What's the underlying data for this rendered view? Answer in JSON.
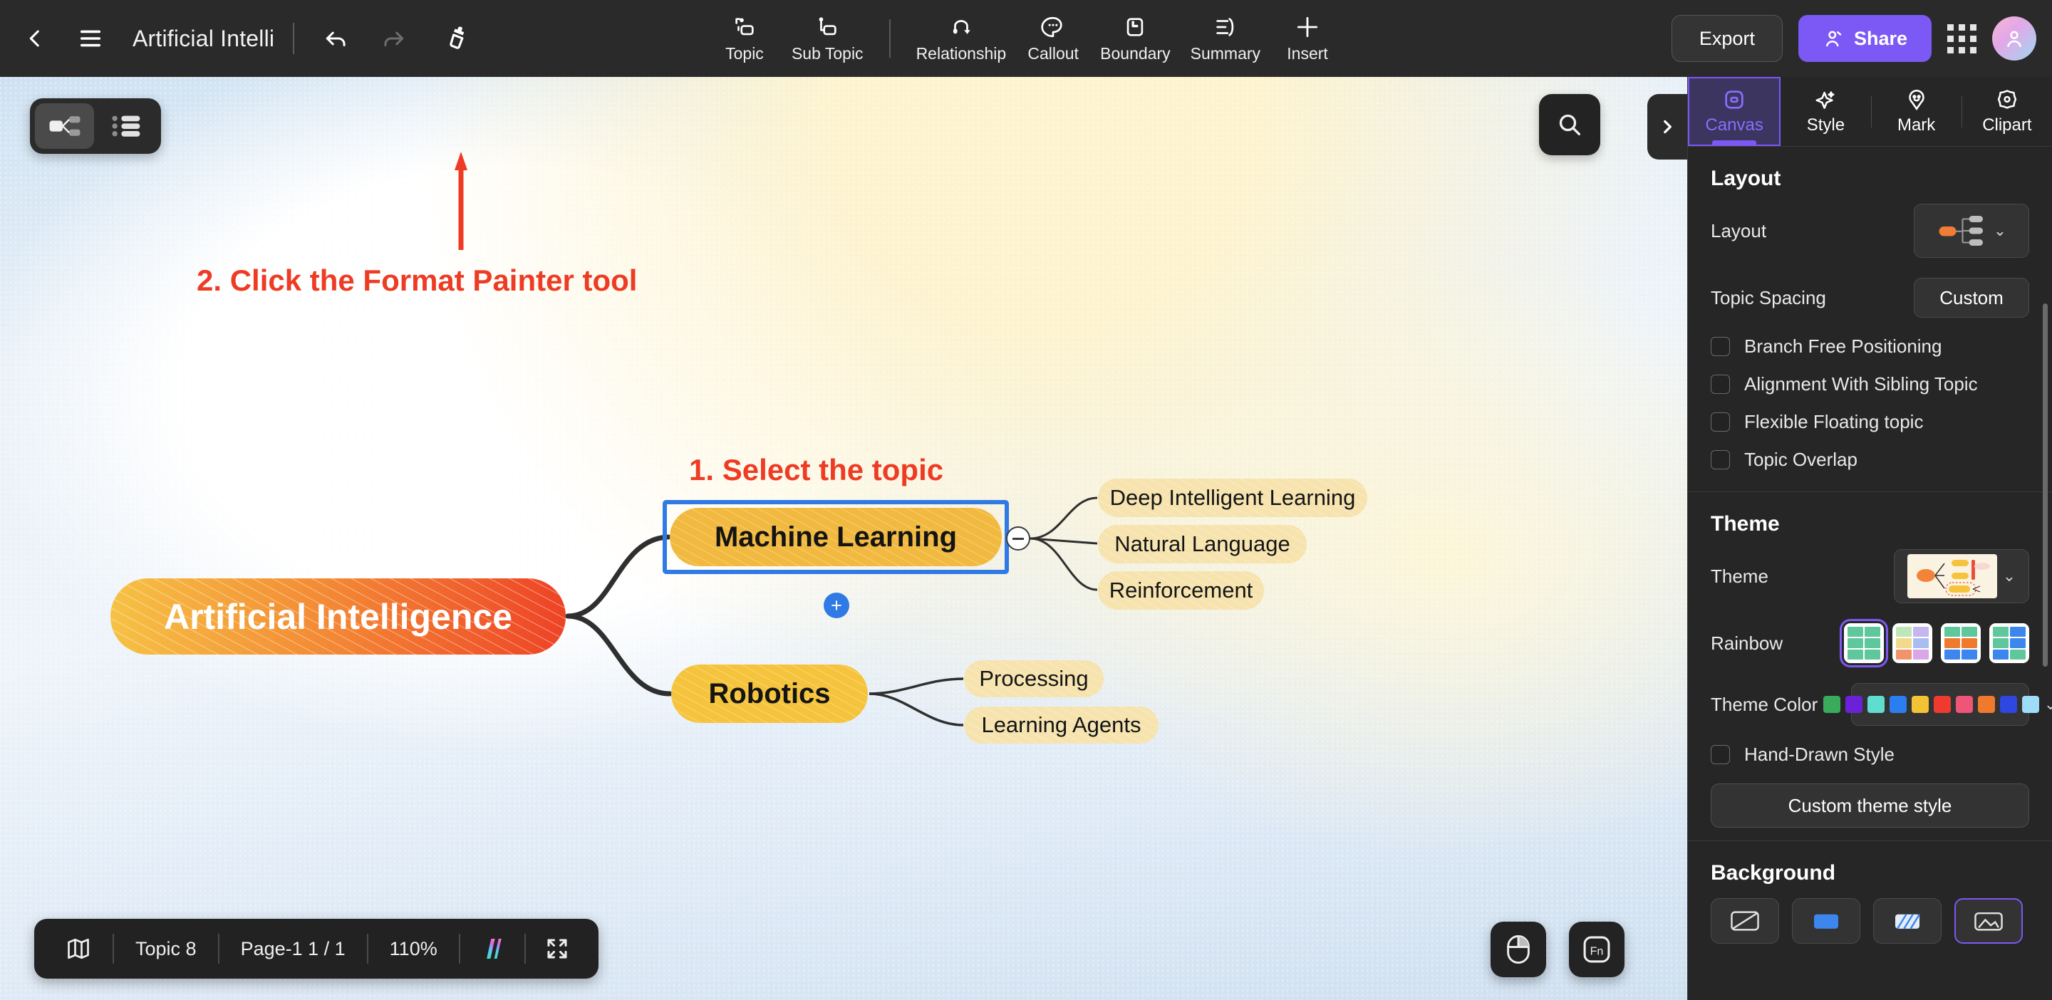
{
  "topbar": {
    "back_icon": "chevron-left-icon",
    "menu_icon": "hamburger-menu-icon",
    "title": "Artificial Intelli",
    "undo_icon": "undo-icon",
    "redo_icon": "redo-icon",
    "format_painter_icon": "format-painter-icon",
    "tools": [
      {
        "label": "Topic",
        "icon": "topic-icon"
      },
      {
        "label": "Sub Topic",
        "icon": "sub-topic-icon"
      },
      {
        "label": "Relationship",
        "icon": "relationship-icon"
      },
      {
        "label": "Callout",
        "icon": "callout-icon"
      },
      {
        "label": "Boundary",
        "icon": "boundary-icon"
      },
      {
        "label": "Summary",
        "icon": "summary-icon"
      },
      {
        "label": "Insert",
        "icon": "plus-icon"
      }
    ],
    "export_label": "Export",
    "share_label": "Share",
    "share_icon": "person-add-icon",
    "apps_icon": "app-grid-icon",
    "avatar_icon": "user-avatar-icon",
    "share_color": "#7c58f5"
  },
  "canvas": {
    "view_toggle": {
      "map_view_icon": "mindmap-view-icon",
      "outline_view_icon": "outline-view-icon",
      "active": "mindmap-view-icon"
    },
    "annotations": [
      {
        "id": "step2",
        "text": "2. Click the Format Painter tool",
        "color": "#ee3b23"
      },
      {
        "id": "step1",
        "text": "1. Select the topic",
        "color": "#ee3b23"
      }
    ],
    "search_icon": "search-icon",
    "panel_collapse_icon": "chevron-right-icon",
    "selected_topic": "Machine Learning",
    "collapse_toggle_icon": "minus-circle-icon",
    "add_topic_icon": "plus-circle-icon"
  },
  "mindmap": {
    "root": {
      "text": "Artificial Intelligence",
      "color_from": "#f6c244",
      "color_to": "#ef4a27"
    },
    "branches": [
      {
        "text": "Machine Learning",
        "color": "#f1b93f",
        "selected": true,
        "children": [
          {
            "text": "Deep Intelligent Learning",
            "color": "#f6e3ae"
          },
          {
            "text": "Natural Language",
            "color": "#f6e3ae"
          },
          {
            "text": "Reinforcement",
            "color": "#f6e3ae"
          }
        ]
      },
      {
        "text": "Robotics",
        "color": "#f5c43c",
        "selected": false,
        "children": [
          {
            "text": "Processing",
            "color": "#f6e3ae"
          },
          {
            "text": "Learning Agents",
            "color": "#f6e3ae"
          }
        ]
      }
    ]
  },
  "statusbar": {
    "map_icon": "map-icon",
    "topic_count": "Topic 8",
    "page_label": "Page-1  1 / 1",
    "zoom": "110%",
    "ai_icon": "ai-gradient-icon",
    "fullscreen_icon": "fullscreen-icon"
  },
  "float_buttons": [
    {
      "icon": "mouse-icon",
      "label": ""
    },
    {
      "icon": "fn-key-icon",
      "label": "Fn"
    }
  ],
  "right_panel": {
    "tabs": [
      {
        "label": "Canvas",
        "icon": "canvas-icon",
        "active": true
      },
      {
        "label": "Style",
        "icon": "sparkle-icon",
        "active": false
      },
      {
        "label": "Mark",
        "icon": "mark-pin-icon",
        "active": false
      },
      {
        "label": "Clipart",
        "icon": "clipart-icon",
        "active": false
      }
    ],
    "layout": {
      "title": "Layout",
      "layout_label": "Layout",
      "layout_value_icon": "layout-right-map-icon",
      "topic_spacing_label": "Topic Spacing",
      "topic_spacing_value": "Custom",
      "checkboxes": [
        {
          "label": "Branch Free Positioning",
          "checked": false
        },
        {
          "label": "Alignment With Sibling Topic",
          "checked": false
        },
        {
          "label": "Flexible Floating topic",
          "checked": false
        },
        {
          "label": "Topic Overlap",
          "checked": false
        }
      ]
    },
    "theme": {
      "title": "Theme",
      "theme_label": "Theme",
      "theme_preview_icon": "theme-preview-thumbnail",
      "rainbow_label": "Rainbow",
      "rainbow_options": [
        {
          "name": "all-green",
          "colors": [
            "#5ec79c",
            "#5ec79c",
            "#5ec79c",
            "#5ec79c",
            "#5ec79c",
            "#5ec79c"
          ],
          "selected": true
        },
        {
          "name": "pastel-mix",
          "colors": [
            "#bfe6b8",
            "#8fd6c0",
            "#f2d98b",
            "#c5b6ef",
            "#f3936a",
            "#d9a6e8"
          ],
          "selected": false
        },
        {
          "name": "green-orange-blue",
          "colors": [
            "#5ec79c",
            "#5ec79c",
            "#ef7a2e",
            "#ef7a2e",
            "#3d86ed",
            "#3d86ed"
          ],
          "selected": false
        },
        {
          "name": "green-blue",
          "colors": [
            "#5ec79c",
            "#3d86ed",
            "#5ec79c",
            "#3d86ed",
            "#3d86ed",
            "#5ec79c"
          ],
          "selected": false
        }
      ],
      "theme_color_label": "Theme Color",
      "theme_colors": [
        "#3aab5c",
        "#6b21d8",
        "#5fded0",
        "#2b7ef0",
        "#f2c335",
        "#ef3a2f",
        "#ee5577",
        "#ef7a2e",
        "#2d47e0",
        "#9fdcf7"
      ],
      "hand_drawn_label": "Hand-Drawn Style",
      "hand_drawn_checked": false,
      "custom_theme_style_label": "Custom theme style"
    },
    "background": {
      "title": "Background",
      "options": [
        {
          "name": "bg-none",
          "selected": false
        },
        {
          "name": "bg-color",
          "selected": false
        },
        {
          "name": "bg-pattern",
          "selected": false
        },
        {
          "name": "bg-image",
          "selected": true
        }
      ]
    }
  }
}
